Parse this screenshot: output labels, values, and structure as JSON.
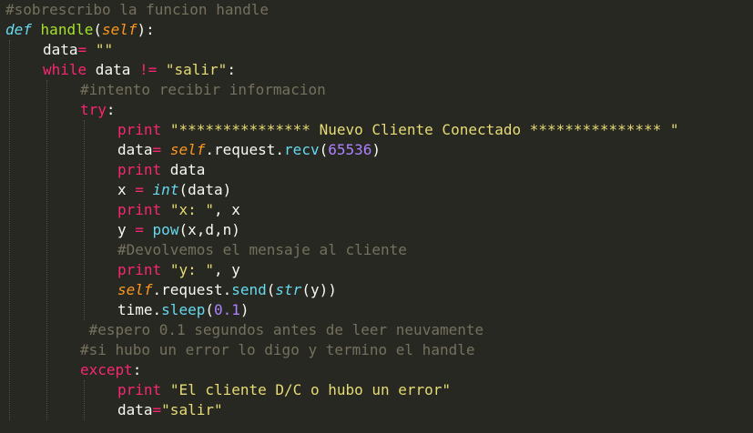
{
  "editor": {
    "theme_colors": {
      "background": "#272822",
      "text": "#f8f8f2",
      "comment": "#75715e",
      "keyword": "#f92672",
      "function": "#a6e22e",
      "string": "#e6db74",
      "number": "#ae81ff",
      "self": "#fd971f",
      "builtin": "#66d9ef"
    },
    "lines": [
      {
        "indent": 0,
        "tokens": [
          {
            "t": "comment",
            "v": "#sobrescribo la funcion handle"
          }
        ]
      },
      {
        "indent": 0,
        "tokens": [
          {
            "t": "storage",
            "v": "def"
          },
          {
            "t": "plain",
            "v": " "
          },
          {
            "t": "func",
            "v": "handle"
          },
          {
            "t": "plain",
            "v": "("
          },
          {
            "t": "selfkw",
            "v": "self"
          },
          {
            "t": "plain",
            "v": "):"
          }
        ]
      },
      {
        "indent": 1,
        "tokens": [
          {
            "t": "plain",
            "v": "data"
          },
          {
            "t": "keyword",
            "v": "="
          },
          {
            "t": "plain",
            "v": " "
          },
          {
            "t": "string",
            "v": "\"\""
          }
        ]
      },
      {
        "indent": 1,
        "tokens": [
          {
            "t": "keyword",
            "v": "while"
          },
          {
            "t": "plain",
            "v": " data "
          },
          {
            "t": "keyword",
            "v": "!="
          },
          {
            "t": "plain",
            "v": " "
          },
          {
            "t": "string",
            "v": "\"salir\""
          },
          {
            "t": "plain",
            "v": ":"
          }
        ]
      },
      {
        "indent": 2,
        "tokens": [
          {
            "t": "comment",
            "v": "#intento recibir informacion"
          }
        ]
      },
      {
        "indent": 2,
        "tokens": [
          {
            "t": "keyword",
            "v": "try"
          },
          {
            "t": "plain",
            "v": ":"
          }
        ]
      },
      {
        "indent": 3,
        "tokens": [
          {
            "t": "keyword",
            "v": "print"
          },
          {
            "t": "plain",
            "v": " "
          },
          {
            "t": "string",
            "v": "\"*************** Nuevo Cliente Conectado *************** \""
          }
        ]
      },
      {
        "indent": 3,
        "tokens": [
          {
            "t": "plain",
            "v": "data"
          },
          {
            "t": "keyword",
            "v": "="
          },
          {
            "t": "plain",
            "v": " "
          },
          {
            "t": "selfkw",
            "v": "self"
          },
          {
            "t": "plain",
            "v": ".request."
          },
          {
            "t": "call",
            "v": "recv"
          },
          {
            "t": "plain",
            "v": "("
          },
          {
            "t": "number",
            "v": "65536"
          },
          {
            "t": "plain",
            "v": ")"
          }
        ]
      },
      {
        "indent": 3,
        "tokens": [
          {
            "t": "keyword",
            "v": "print"
          },
          {
            "t": "plain",
            "v": " data"
          }
        ]
      },
      {
        "indent": 3,
        "tokens": [
          {
            "t": "plain",
            "v": "x "
          },
          {
            "t": "keyword",
            "v": "="
          },
          {
            "t": "plain",
            "v": " "
          },
          {
            "t": "builtin",
            "v": "int"
          },
          {
            "t": "plain",
            "v": "(data)"
          }
        ]
      },
      {
        "indent": 3,
        "tokens": [
          {
            "t": "keyword",
            "v": "print"
          },
          {
            "t": "plain",
            "v": " "
          },
          {
            "t": "string",
            "v": "\"x: \""
          },
          {
            "t": "plain",
            "v": ", x"
          }
        ]
      },
      {
        "indent": 3,
        "tokens": [
          {
            "t": "plain",
            "v": "y "
          },
          {
            "t": "keyword",
            "v": "="
          },
          {
            "t": "plain",
            "v": " "
          },
          {
            "t": "call",
            "v": "pow"
          },
          {
            "t": "plain",
            "v": "(x,d,n)"
          }
        ]
      },
      {
        "indent": 3,
        "tokens": [
          {
            "t": "comment",
            "v": "#Devolvemos el mensaje al cliente"
          }
        ]
      },
      {
        "indent": 3,
        "tokens": [
          {
            "t": "keyword",
            "v": "print"
          },
          {
            "t": "plain",
            "v": " "
          },
          {
            "t": "string",
            "v": "\"y: \""
          },
          {
            "t": "plain",
            "v": ", y"
          }
        ]
      },
      {
        "indent": 3,
        "tokens": [
          {
            "t": "selfkw",
            "v": "self"
          },
          {
            "t": "plain",
            "v": ".request."
          },
          {
            "t": "call",
            "v": "send"
          },
          {
            "t": "plain",
            "v": "("
          },
          {
            "t": "builtin",
            "v": "str"
          },
          {
            "t": "plain",
            "v": "(y))"
          }
        ]
      },
      {
        "indent": 3,
        "tokens": [
          {
            "t": "plain",
            "v": "time."
          },
          {
            "t": "call",
            "v": "sleep"
          },
          {
            "t": "plain",
            "v": "("
          },
          {
            "t": "number",
            "v": "0.1"
          },
          {
            "t": "plain",
            "v": ")"
          }
        ]
      },
      {
        "indent": 2,
        "lead": " ",
        "tokens": [
          {
            "t": "comment",
            "v": "#espero 0.1 segundos antes de leer neuvamente"
          }
        ]
      },
      {
        "indent": 2,
        "tokens": [
          {
            "t": "comment",
            "v": "#si hubo un error lo digo y termino el handle"
          }
        ]
      },
      {
        "indent": 2,
        "tokens": [
          {
            "t": "keyword",
            "v": "except"
          },
          {
            "t": "plain",
            "v": ":"
          }
        ]
      },
      {
        "indent": 3,
        "tokens": [
          {
            "t": "keyword",
            "v": "print"
          },
          {
            "t": "plain",
            "v": " "
          },
          {
            "t": "string",
            "v": "\"El cliente D/C o hubo un error\""
          }
        ]
      },
      {
        "indent": 3,
        "tokens": [
          {
            "t": "plain",
            "v": "data"
          },
          {
            "t": "keyword",
            "v": "="
          },
          {
            "t": "string",
            "v": "\"salir\""
          }
        ]
      }
    ]
  }
}
